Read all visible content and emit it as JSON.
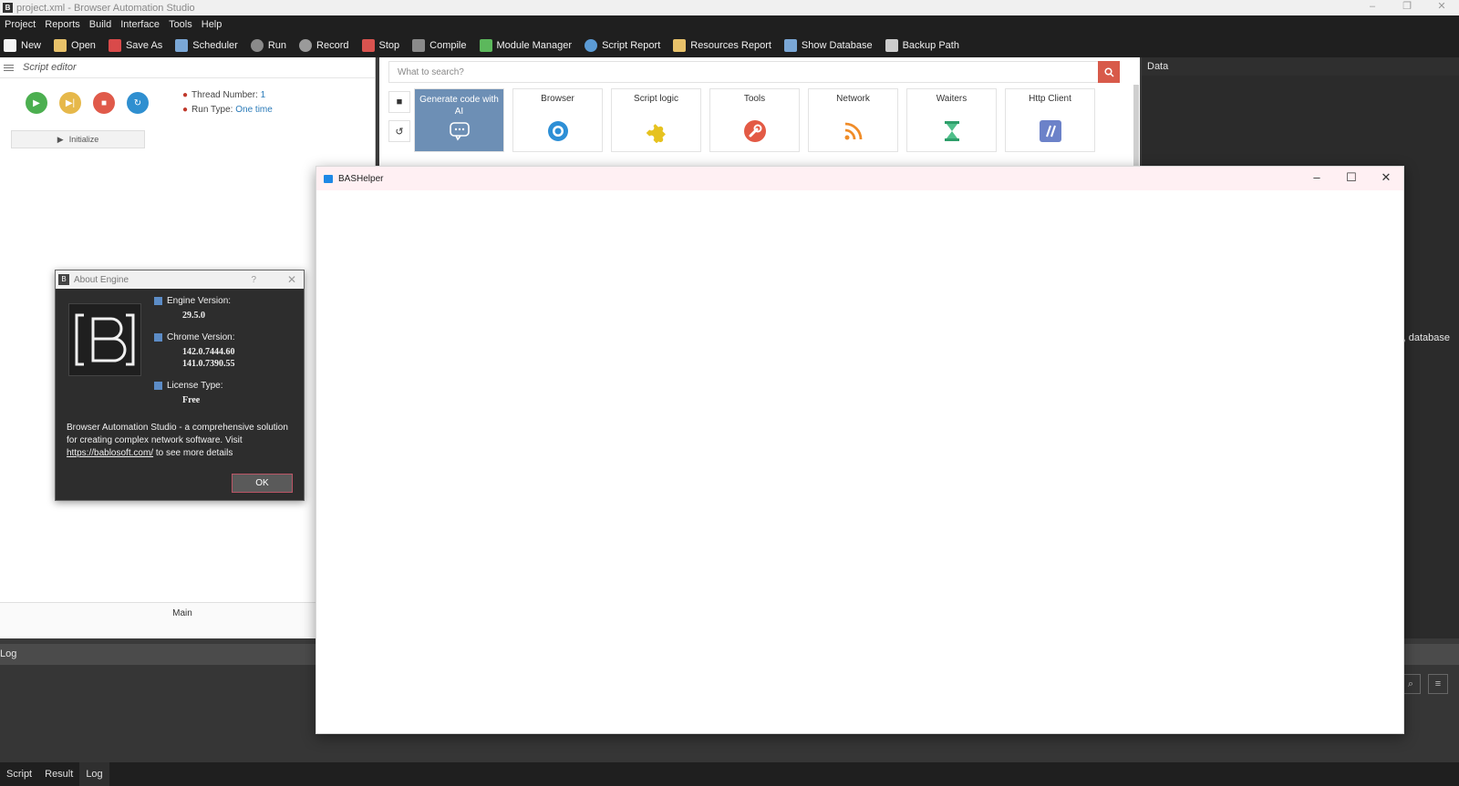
{
  "window": {
    "title": "project.xml - Browser Automation Studio",
    "controls": [
      "–",
      "❐",
      "✕"
    ]
  },
  "menu": [
    "Project",
    "Reports",
    "Build",
    "Interface",
    "Tools",
    "Help"
  ],
  "toolbar": [
    {
      "label": "New",
      "icon": "new-icon",
      "color": "#f5f5f5"
    },
    {
      "label": "Open",
      "icon": "folder-icon",
      "color": "#e8c26a"
    },
    {
      "label": "Save As",
      "icon": "save-icon",
      "color": "#d94a4a"
    },
    {
      "label": "Scheduler",
      "icon": "scheduler-icon",
      "color": "#7aa7d6"
    },
    {
      "label": "Run",
      "icon": "run-icon",
      "color": "#8a8a8a"
    },
    {
      "label": "Record",
      "icon": "record-icon",
      "color": "#9a9a9a"
    },
    {
      "label": "Stop",
      "icon": "stop-icon",
      "color": "#d9534f"
    },
    {
      "label": "Compile",
      "icon": "compile-icon",
      "color": "#8a8a8a"
    },
    {
      "label": "Module Manager",
      "icon": "puzzle-icon",
      "color": "#5cb85c"
    },
    {
      "label": "Script Report",
      "icon": "pie-chart-icon",
      "color": "#5b9bd5"
    },
    {
      "label": "Resources Report",
      "icon": "resources-icon",
      "color": "#e8c26a"
    },
    {
      "label": "Show Database",
      "icon": "database-icon",
      "color": "#7aa7d6"
    },
    {
      "label": "Backup Path",
      "icon": "backup-icon",
      "color": "#cccccc"
    }
  ],
  "script_editor": {
    "title": "Script editor",
    "thread_number_label": "Thread Number:",
    "thread_number_value": "1",
    "run_type_label": "Run Type:",
    "run_type_value": "One time",
    "init_label": "Initialize",
    "main_tab": "Main"
  },
  "actions": {
    "search_placeholder": "What to search?",
    "cards": [
      {
        "label": "Generate code with AI",
        "icon": "chat-bubble-icon"
      },
      {
        "label": "Browser",
        "icon": "browser-icon"
      },
      {
        "label": "Script logic",
        "icon": "puzzle-icon"
      },
      {
        "label": "Tools",
        "icon": "wrench-icon"
      },
      {
        "label": "Network",
        "icon": "rss-icon"
      },
      {
        "label": "Waiters",
        "icon": "hourglass-icon"
      },
      {
        "label": "Http Client",
        "icon": "http-icon"
      }
    ]
  },
  "data_panel": {
    "title": "Data",
    "database_label": ", database"
  },
  "log": {
    "title": "Log"
  },
  "bottom_tabs": [
    "Script",
    "Result",
    "Log"
  ],
  "about": {
    "title": "About Engine",
    "help": "?",
    "engine_label": "Engine Version:",
    "engine_value": "29.5.0",
    "chrome_label": "Chrome Version:",
    "chrome_value_1": "142.0.7444.60",
    "chrome_value_2": "141.0.7390.55",
    "license_label": "License Type:",
    "license_value": "Free",
    "desc_1": "Browser Automation Studio - a comprehensive solution for creating complex network software.",
    "desc_visit": "Visit",
    "link": "https://bablosoft.com/",
    "desc_2": "to see more details",
    "ok": "OK"
  },
  "helper": {
    "title": "BASHelper"
  }
}
